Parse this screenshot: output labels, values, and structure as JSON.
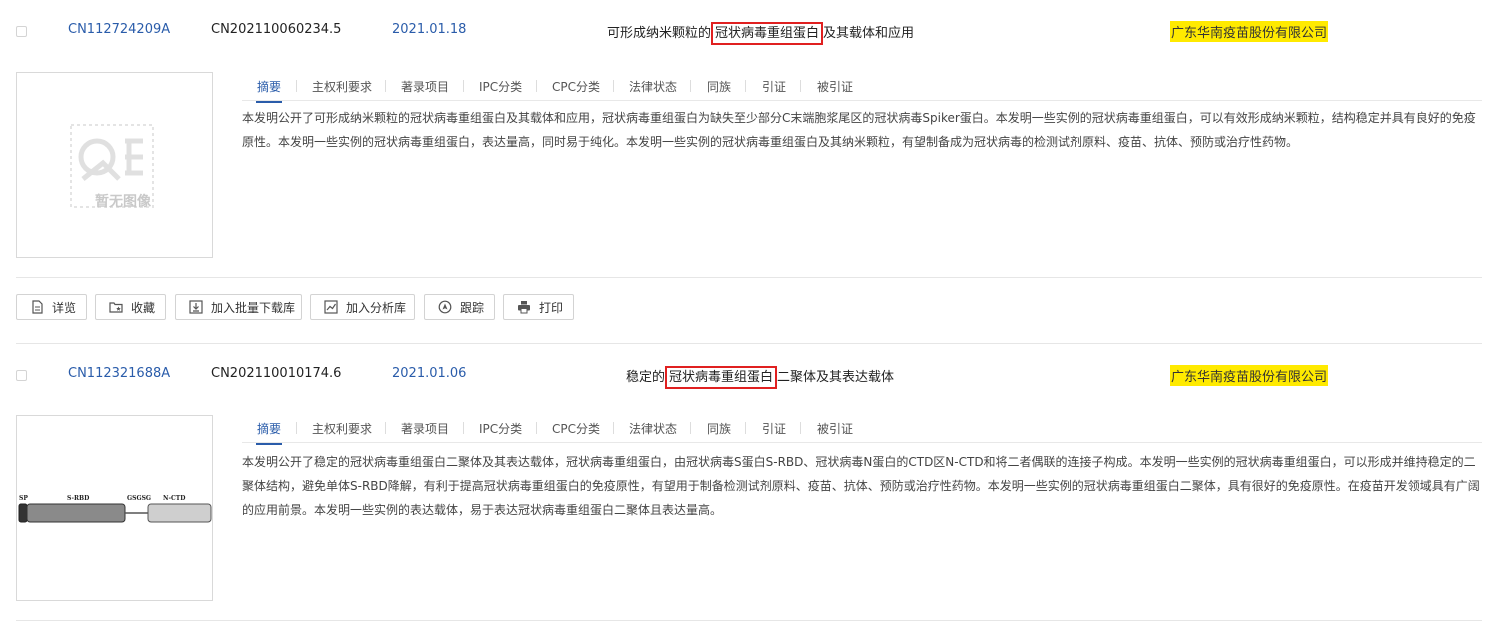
{
  "records": [
    {
      "pub_no": "CN112724209A",
      "app_no": "CN202110060234.5",
      "date": "2021.01.18",
      "title_pre": "可形成纳米颗粒的",
      "title_hl": "冠状病毒重组蛋白",
      "title_post": "及其载体和应用",
      "applicant": "广东华南疫苗股份有限公司",
      "image_placeholder": "暂无图像",
      "abstract": "本发明公开了可形成纳米颗粒的冠状病毒重组蛋白及其载体和应用，冠状病毒重组蛋白为缺失至少部分C末端胞浆尾区的冠状病毒Spiker蛋白。本发明一些实例的冠状病毒重组蛋白，可以有效形成纳米颗粒，结构稳定并具有良好的免疫原性。本发明一些实例的冠状病毒重组蛋白，表达量高，同时易于纯化。本发明一些实例的冠状病毒重组蛋白及其纳米颗粒，有望制备成为冠状病毒的检测试剂原料、疫苗、抗体、预防或治疗性药物。"
    },
    {
      "pub_no": "CN112321688A",
      "app_no": "CN202110010174.6",
      "date": "2021.01.06",
      "title_pre": "稳定的",
      "title_hl": "冠状病毒重组蛋白",
      "title_post": "二聚体及其表达载体",
      "applicant": "广东华南疫苗股份有限公司",
      "diagram_labels": [
        "SP",
        "S-RBD",
        "GSGSG",
        "N-CTD"
      ],
      "abstract": "本发明公开了稳定的冠状病毒重组蛋白二聚体及其表达载体，冠状病毒重组蛋白，由冠状病毒S蛋白S-RBD、冠状病毒N蛋白的CTD区N-CTD和将二者偶联的连接子构成。本发明一些实例的冠状病毒重组蛋白，可以形成并维持稳定的二聚体结构，避免单体S-RBD降解，有利于提高冠状病毒重组蛋白的免疫原性，有望用于制备检测试剂原料、疫苗、抗体、预防或治疗性药物。本发明一些实例的冠状病毒重组蛋白二聚体，具有很好的免疫原性。在疫苗开发领域具有广阔的应用前景。本发明一些实例的表达载体，易于表达冠状病毒重组蛋白二聚体且表达量高。"
    }
  ],
  "tabs": [
    "摘要",
    "主权利要求",
    "著录项目",
    "IPC分类",
    "CPC分类",
    "法律状态",
    "同族",
    "引证",
    "被引证"
  ],
  "toolbar": {
    "detail": "详览",
    "favorite": "收藏",
    "batch_download": "加入批量下载库",
    "analysis": "加入分析库",
    "track": "跟踪",
    "print": "打印"
  },
  "colors": {
    "link_blue": "#2a5caa",
    "highlight_yellow": "#ffea00",
    "highlight_border": "#e02020"
  }
}
